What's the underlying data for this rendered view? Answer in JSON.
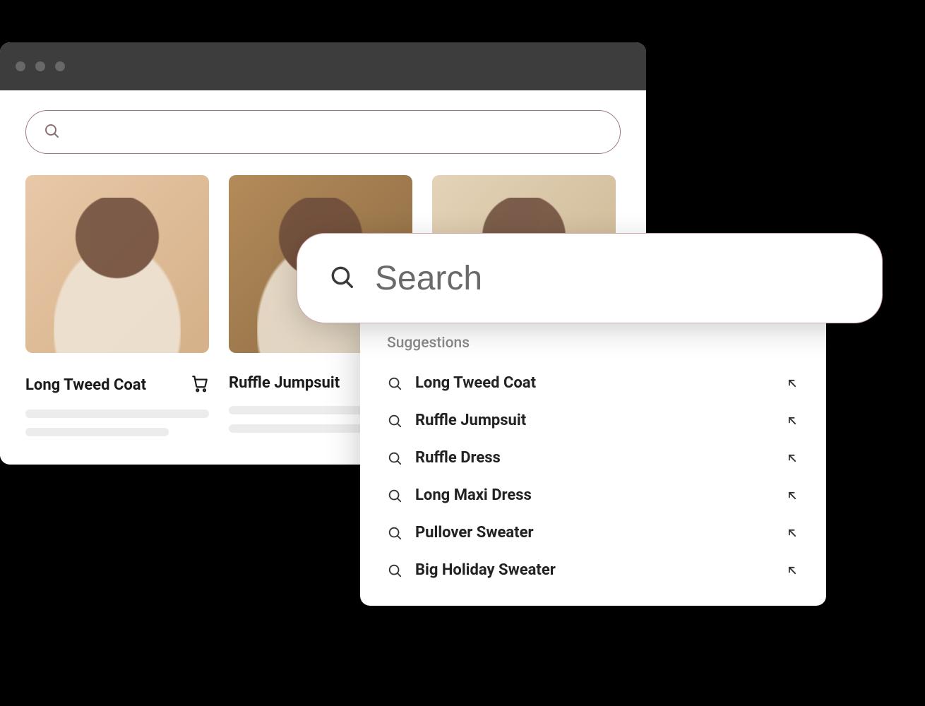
{
  "top_search": {
    "placeholder": ""
  },
  "products": [
    {
      "title": "Long Tweed Coat"
    },
    {
      "title": "Ruffle Jumpsuit"
    },
    {
      "title": ""
    }
  ],
  "overlay_search": {
    "placeholder": "Search"
  },
  "suggestions_heading": "Suggestions",
  "suggestions": [
    {
      "label": "Long Tweed Coat"
    },
    {
      "label": "Ruffle Jumpsuit"
    },
    {
      "label": "Ruffle Dress"
    },
    {
      "label": "Long Maxi Dress"
    },
    {
      "label": "Pullover Sweater"
    },
    {
      "label": "Big Holiday Sweater"
    }
  ]
}
